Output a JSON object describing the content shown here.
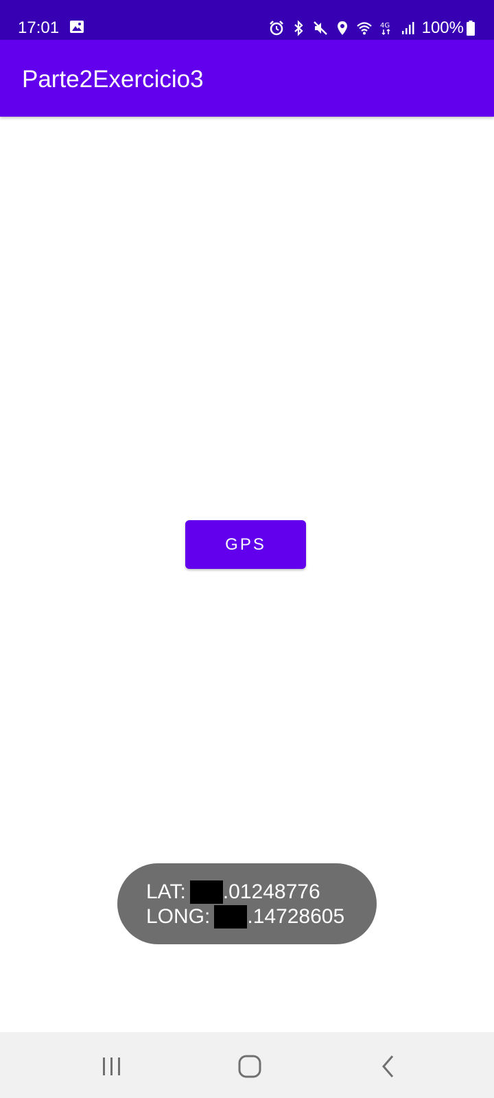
{
  "status_bar": {
    "time": "17:01",
    "icons": [
      "gallery-icon",
      "alarm-icon",
      "bluetooth-icon",
      "mute-icon",
      "location-icon",
      "wifi-icon",
      "4g-icon",
      "signal-icon",
      "battery-icon"
    ],
    "network_label": "4G",
    "battery": "100%"
  },
  "app_bar": {
    "title": "Parte2Exercicio3"
  },
  "main": {
    "gps_button_label": "GPS"
  },
  "toast": {
    "lat_label": "LAT:",
    "lat_value": ".01248776",
    "long_label": "LONG:",
    "long_value": ".14728605"
  },
  "nav_bar": {
    "buttons": [
      "recents-icon",
      "home-icon",
      "back-icon"
    ]
  },
  "colors": {
    "status_bar": "#3700b3",
    "app_bar": "#6200ee",
    "button": "#6200ee",
    "toast_bg": "#6e6e6e",
    "nav_bar": "#f1f1f1"
  }
}
